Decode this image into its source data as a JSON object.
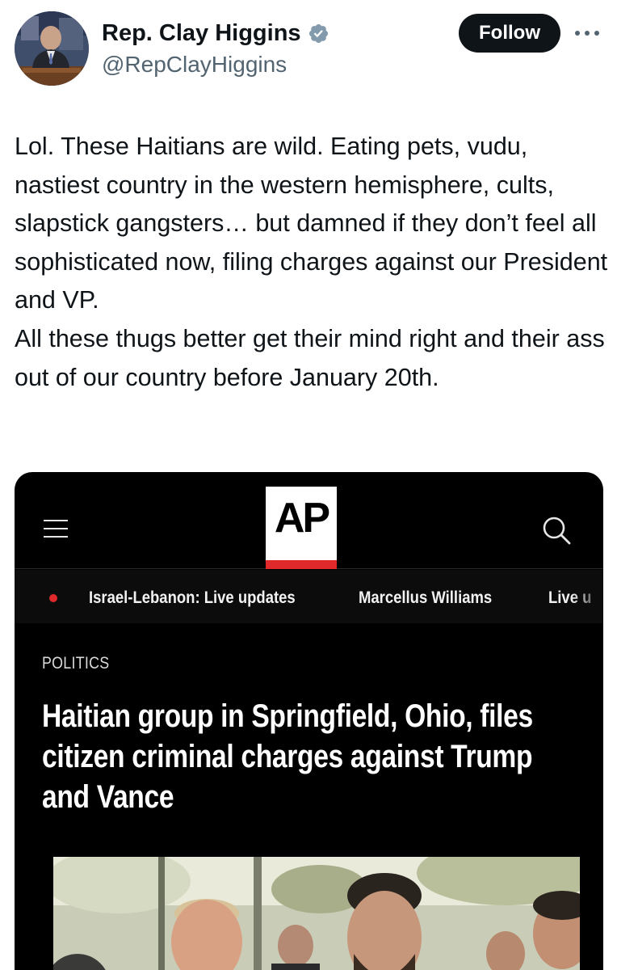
{
  "author": {
    "name": "Rep. Clay Higgins",
    "handle": "@RepClayHiggins",
    "verified": true,
    "verified_color": "#71767b"
  },
  "actions": {
    "follow_label": "Follow",
    "more_icon": "more-horizontal-icon"
  },
  "tweet": {
    "text": "Lol. These Haitians are wild. Eating pets, vudu, nastiest country in the western hemisphere, cults, slapstick gangsters… but damned if they don’t feel all sophisticated now, filing charges against our President and VP.\n  All these thugs better get their mind right and their ass out of our country before January 20th."
  },
  "card": {
    "logo_text": "AP",
    "logo_accent": "#e0292a",
    "nav_items": [
      "Israel-Lebanon: Live updates",
      "Marcellus Williams",
      "Live u"
    ],
    "section": "POLITICS",
    "headline": "Haitian group in Springfield, Ohio, files citizen criminal charges against Trump and Vance"
  }
}
